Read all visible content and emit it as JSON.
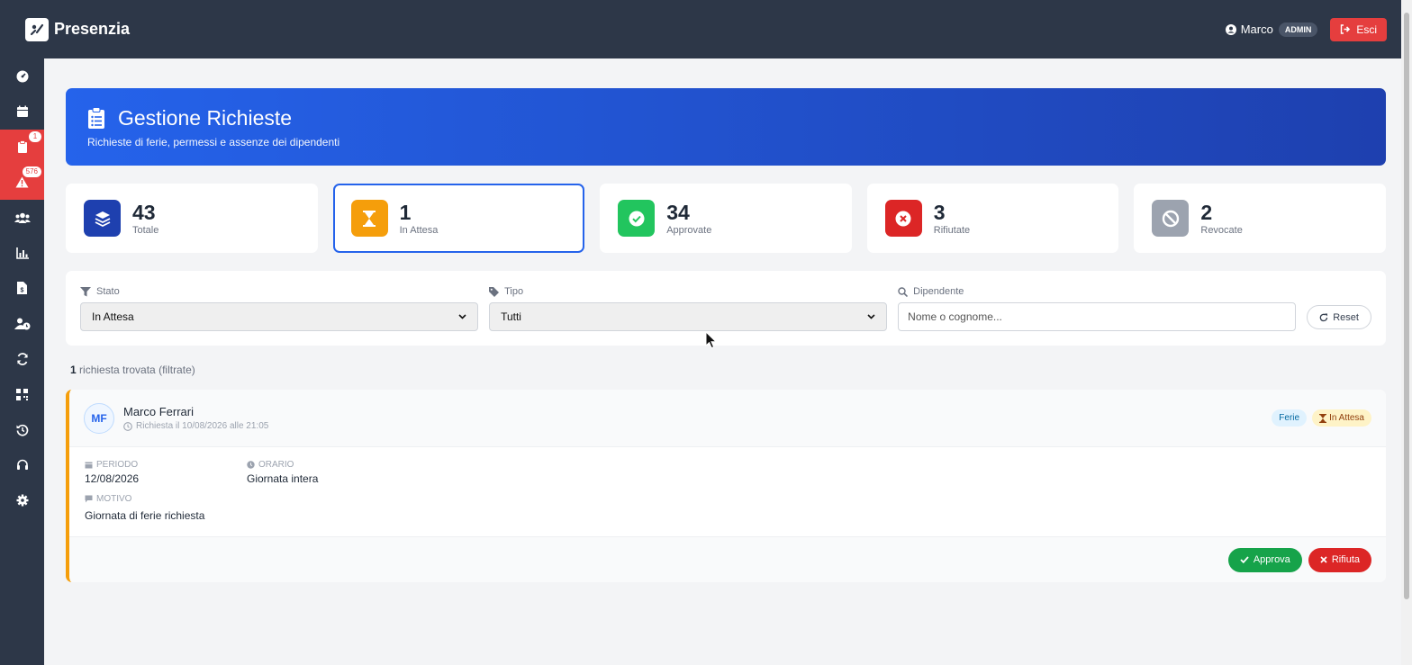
{
  "app": {
    "name": "Presenzia"
  },
  "user": {
    "name": "Marco",
    "role_badge": "ADMIN",
    "logout_label": "Esci"
  },
  "sidebar": {
    "items": [
      {
        "icon": "dashboard-icon"
      },
      {
        "icon": "calendar-icon"
      },
      {
        "icon": "clipboard-icon",
        "badge": "1",
        "active": true
      },
      {
        "icon": "warning-icon",
        "badge": "576",
        "active": true
      },
      {
        "icon": "users-icon"
      },
      {
        "icon": "chart-icon"
      },
      {
        "icon": "invoice-icon"
      },
      {
        "icon": "user-clock-icon"
      },
      {
        "icon": "sync-icon"
      },
      {
        "icon": "qrcode-icon"
      },
      {
        "icon": "history-icon"
      },
      {
        "icon": "headset-icon"
      },
      {
        "icon": "gear-icon"
      }
    ]
  },
  "page": {
    "title": "Gestione Richieste",
    "subtitle": "Richieste di ferie, permessi e assenze dei dipendenti"
  },
  "stats": [
    {
      "value": "43",
      "label": "Totale",
      "color": "#1e40af",
      "icon": "layers-icon"
    },
    {
      "value": "1",
      "label": "In Attesa",
      "color": "#f59e0b",
      "icon": "hourglass-icon",
      "selected": true
    },
    {
      "value": "34",
      "label": "Approvate",
      "color": "#22c55e",
      "icon": "check-circle-icon"
    },
    {
      "value": "3",
      "label": "Rifiutate",
      "color": "#dc2626",
      "icon": "x-circle-icon"
    },
    {
      "value": "2",
      "label": "Revocate",
      "color": "#9ca3af",
      "icon": "ban-icon"
    }
  ],
  "filters": {
    "status": {
      "label": "Stato",
      "value": "In Attesa"
    },
    "type": {
      "label": "Tipo",
      "value": "Tutti"
    },
    "employee": {
      "label": "Dipendente",
      "placeholder": "Nome o cognome..."
    },
    "reset_label": "Reset"
  },
  "results": {
    "count": "1",
    "text": "richiesta trovata (filtrate)"
  },
  "request": {
    "initials": "MF",
    "name": "Marco Ferrari",
    "date": "Richiesta il 10/08/2026 alle 21:05",
    "type_tag": "Ferie",
    "status_tag": "In Attesa",
    "period_label": "Periodo",
    "period_value": "12/08/2026",
    "time_label": "Orario",
    "time_value": "Giornata intera",
    "reason_label": "Motivo",
    "reason_value": "Giornata di ferie richiesta",
    "approve_label": "Approva",
    "reject_label": "Rifiuta"
  }
}
